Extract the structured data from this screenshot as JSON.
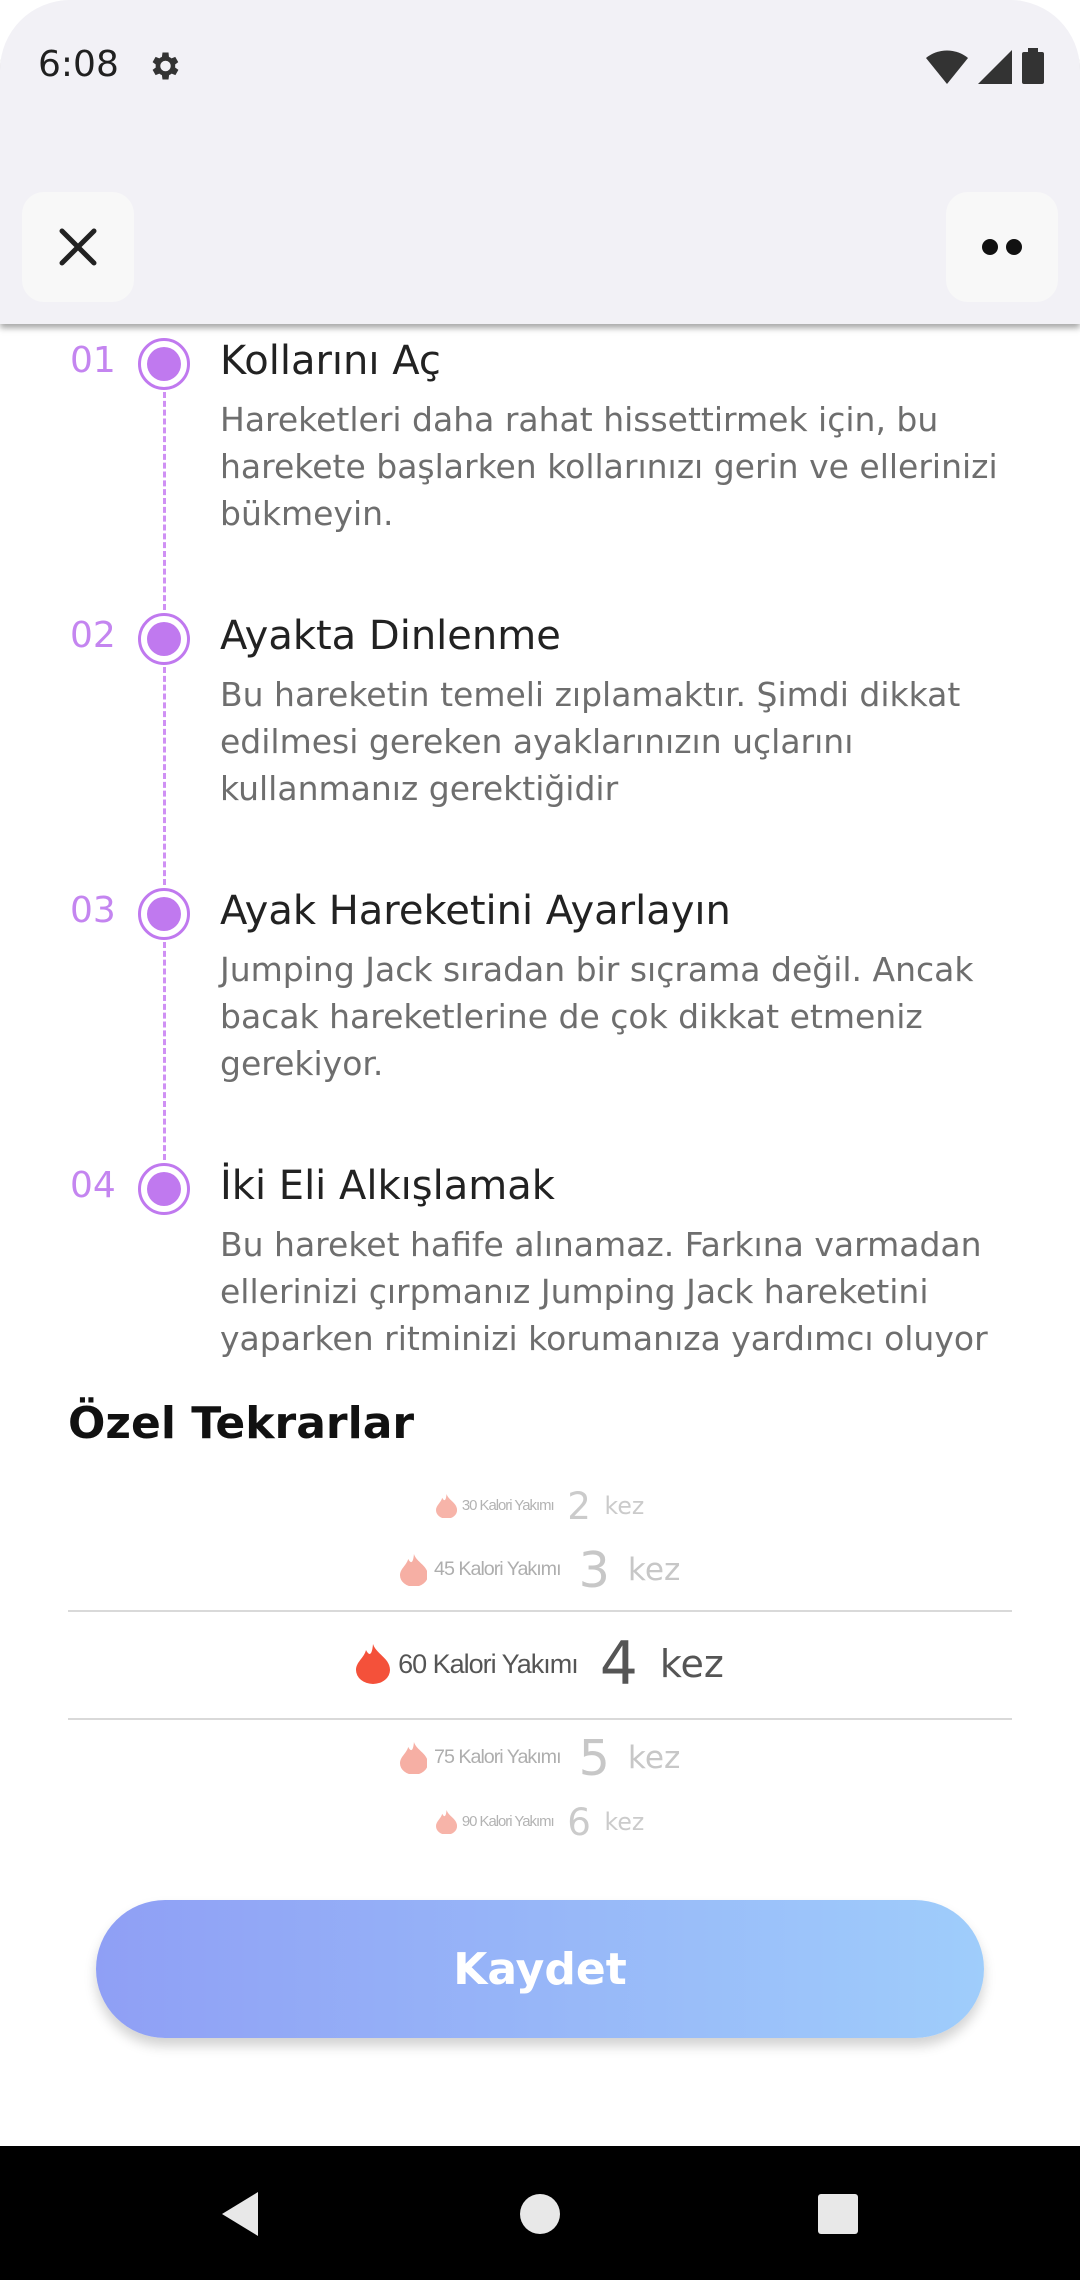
{
  "status_bar": {
    "time": "6:08",
    "icons": [
      "gear-icon",
      "wifi-icon",
      "signal-icon",
      "battery-icon"
    ]
  },
  "header": {
    "close_icon": "close-icon",
    "more_icon": "more-icon"
  },
  "steps": [
    {
      "number": "01",
      "title": "Kollarını Aç",
      "description": "Hareketleri daha rahat hissettirmek için, bu harekete başlarken kollarınızı gerin ve ellerinizi bükmeyin."
    },
    {
      "number": "02",
      "title": "Ayakta Dinlenme",
      "description": "Bu hareketin temeli zıplamaktır. Şimdi dikkat edilmesi gereken ayaklarınızın uçlarını kullanmanız gerektiğidir"
    },
    {
      "number": "03",
      "title": "Ayak Hareketini Ayarlayın",
      "description": "Jumping Jack sıradan bir sıçrama değil. Ancak bacak hareketlerine de çok dikkat etmeniz gerekiyor."
    },
    {
      "number": "04",
      "title": "İki Eli Alkışlamak",
      "description": "Bu hareket hafife alınamaz. Farkına varmadan ellerinizi çırpmanız Jumping Jack hareketini yaparken ritminizi korumanıza yardımcı oluyor"
    }
  ],
  "section_title": "Özel Tekrarlar",
  "picker": {
    "selected_index": 2,
    "options": [
      {
        "calories": "30 Kalori Yakımı",
        "count": "2",
        "unit": "kez"
      },
      {
        "calories": "45 Kalori Yakımı",
        "count": "3",
        "unit": "kez"
      },
      {
        "calories": "60 Kalori Yakımı",
        "count": "4",
        "unit": "kez"
      },
      {
        "calories": "75 Kalori Yakımı",
        "count": "5",
        "unit": "kez"
      },
      {
        "calories": "90 Kalori Yakımı",
        "count": "6",
        "unit": "kez"
      }
    ]
  },
  "save_button": "Kaydet",
  "colors": {
    "accent": "#c079ef",
    "flame_selected": "#f4513a",
    "flame_faded": "#f6a79b",
    "button_start": "#8f9ff5",
    "button_end": "#9fcdfb"
  },
  "nav_icons": [
    "back-icon",
    "home-icon",
    "recents-icon"
  ]
}
